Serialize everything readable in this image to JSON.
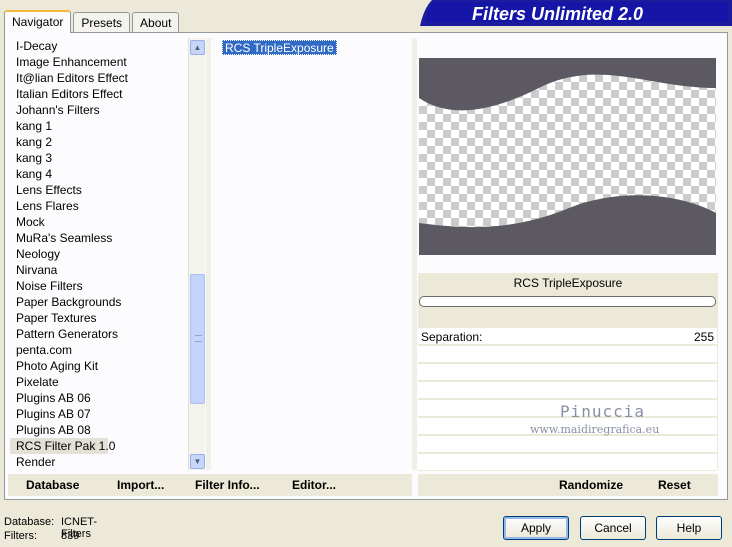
{
  "app": {
    "title": "Filters Unlimited 2.0"
  },
  "tabs": [
    {
      "label": "Navigator",
      "active": true
    },
    {
      "label": "Presets",
      "active": false
    },
    {
      "label": "About",
      "active": false
    }
  ],
  "categories": [
    "I-Decay",
    "Image Enhancement",
    "It@lian Editors Effect",
    "Italian Editors Effect",
    "Johann's Filters",
    "kang 1",
    "kang 2",
    "kang 3",
    "kang 4",
    "Lens Effects",
    "Lens Flares",
    "Mock",
    "MuRa's Seamless",
    "Neology",
    "Nirvana",
    "Noise Filters",
    "Paper Backgrounds",
    "Paper Textures",
    "Pattern Generators",
    "penta.com",
    "Photo Aging Kit",
    "Pixelate",
    "Plugins AB 06",
    "Plugins AB 07",
    "Plugins AB 08",
    "RCS Filter Pak 1.0",
    "Render"
  ],
  "selected_category": "RCS Filter Pak 1.0",
  "filters": [
    "RCS TripleExposure"
  ],
  "selected_filter_name": "RCS TripleExposure",
  "params": [
    {
      "label": "Separation:",
      "value": "255"
    }
  ],
  "watermark": {
    "line1": "Pinuccia",
    "line2": "www.maidiregrafica.eu"
  },
  "left_buttons": {
    "database": "Database",
    "import": "Import...",
    "filter_info": "Filter Info...",
    "editor": "Editor..."
  },
  "right_buttons": {
    "randomize": "Randomize",
    "reset": "Reset"
  },
  "status": {
    "database_label": "Database:",
    "database_value": "ICNET-Filters",
    "filters_label": "Filters:",
    "filters_value": "839"
  },
  "dialog_buttons": {
    "apply": "Apply",
    "cancel": "Cancel",
    "help": "Help"
  },
  "colors": {
    "selection": "#316ac5",
    "banner": "#1c1c9c",
    "preview_dark": "#5c5963"
  }
}
